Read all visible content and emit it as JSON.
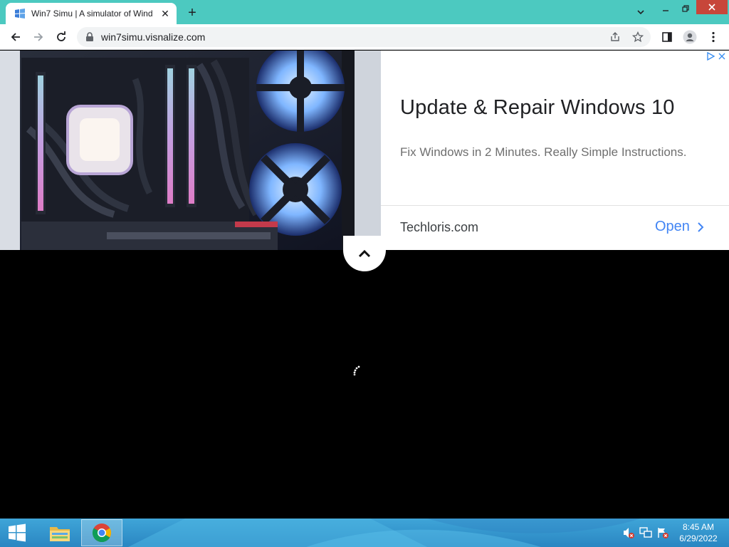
{
  "browser": {
    "tab": {
      "title": "Win7 Simu | A simulator of Wind",
      "favicon": "win7-flag-icon",
      "close": "✕"
    },
    "new_tab": "+",
    "address": "win7simu.visnalize.com",
    "colors": {
      "titlebar": "#4cc9c0",
      "close": "#c7463a"
    }
  },
  "ad": {
    "headline": "Update & Repair Windows 10",
    "description": "Fix Windows in 2 Minutes. Really Simple Instructions.",
    "domain": "Techloris.com",
    "cta": "Open",
    "cta_color": "#4285f4"
  },
  "taskbar": {
    "clock_time": "8:45 AM",
    "clock_date": "6/29/2022",
    "items": [
      "file-explorer-icon",
      "chrome-icon"
    ],
    "tray": [
      "volume-muted-icon",
      "network-icon",
      "action-center-icon"
    ]
  }
}
